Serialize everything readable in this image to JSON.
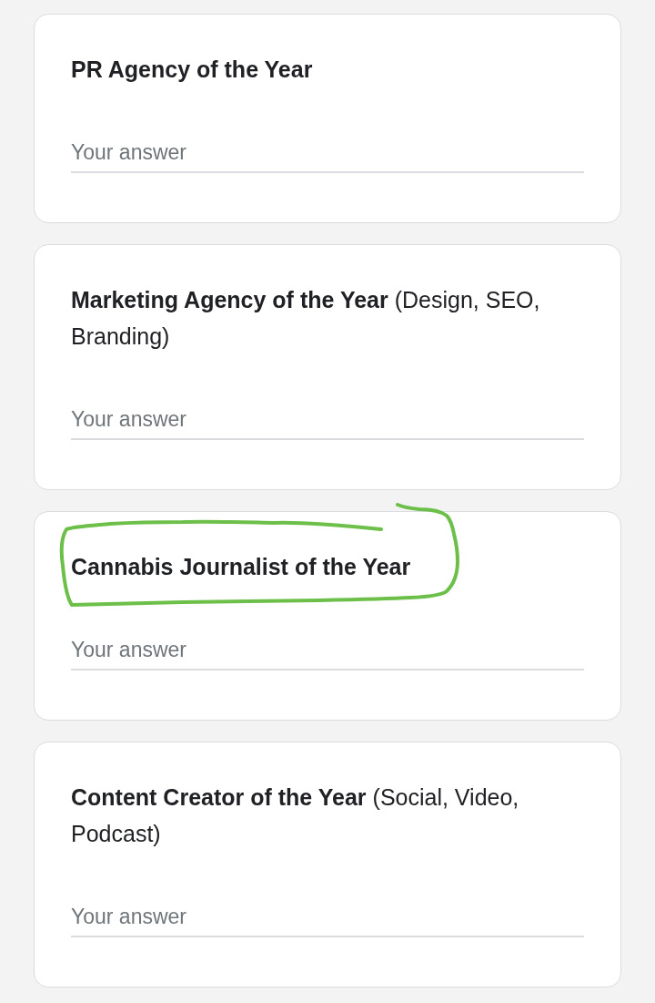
{
  "questions": [
    {
      "title": "PR Agency of the Year",
      "highlighted": false,
      "answer": {
        "placeholder": "Your answer"
      }
    },
    {
      "title": "Marketing Agency of the Year",
      "detail": "(Design, SEO, Branding)",
      "highlighted": false,
      "answer": {
        "placeholder": "Your answer"
      }
    },
    {
      "title": "Cannabis Journalist of the Year",
      "highlighted": true,
      "answer": {
        "placeholder": "Your answer"
      }
    },
    {
      "title": "Content Creator of the Year",
      "detail": "(Social, Video, Podcast)",
      "highlighted": false,
      "answer": {
        "placeholder": "Your answer"
      }
    }
  ]
}
